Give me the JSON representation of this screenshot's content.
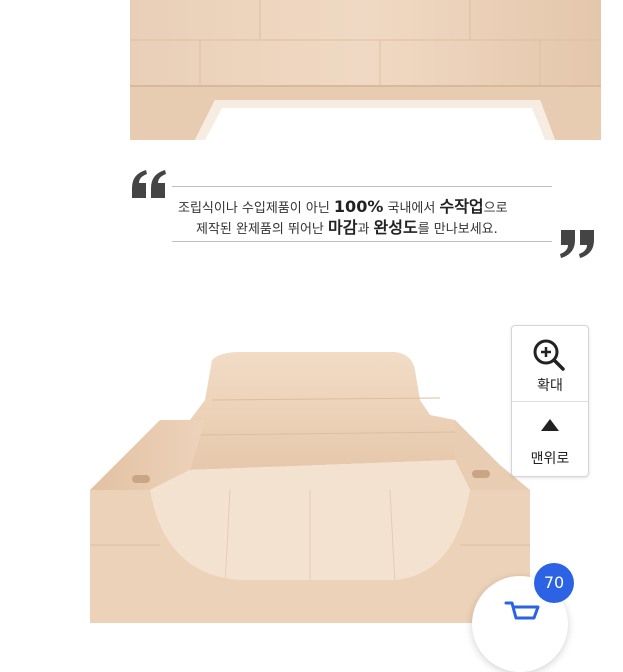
{
  "quote": {
    "line1_part1": "조립식이나 수입제품이 아닌 ",
    "line1_em1": "100%",
    "line1_part2": " 국내에서 ",
    "line1_em2": "수작업",
    "line1_part3": "으로",
    "line2_part1": "제작된 완제품의 뛰어난 ",
    "line2_em1": "마감",
    "line2_part2": "과 ",
    "line2_em2": "완성도",
    "line2_part3": "를 만나보세요."
  },
  "side_panel": {
    "zoom_label": "확대",
    "top_label": "맨위로",
    "zoom_icon": "zoom-in-icon",
    "top_icon": "arrow-up-icon"
  },
  "cart": {
    "count": "70",
    "icon": "cart-icon",
    "accent_color": "#2b63e4"
  },
  "images": {
    "top": "wooden-bed-side-view",
    "bottom": "wooden-pet-bed-perspective"
  }
}
